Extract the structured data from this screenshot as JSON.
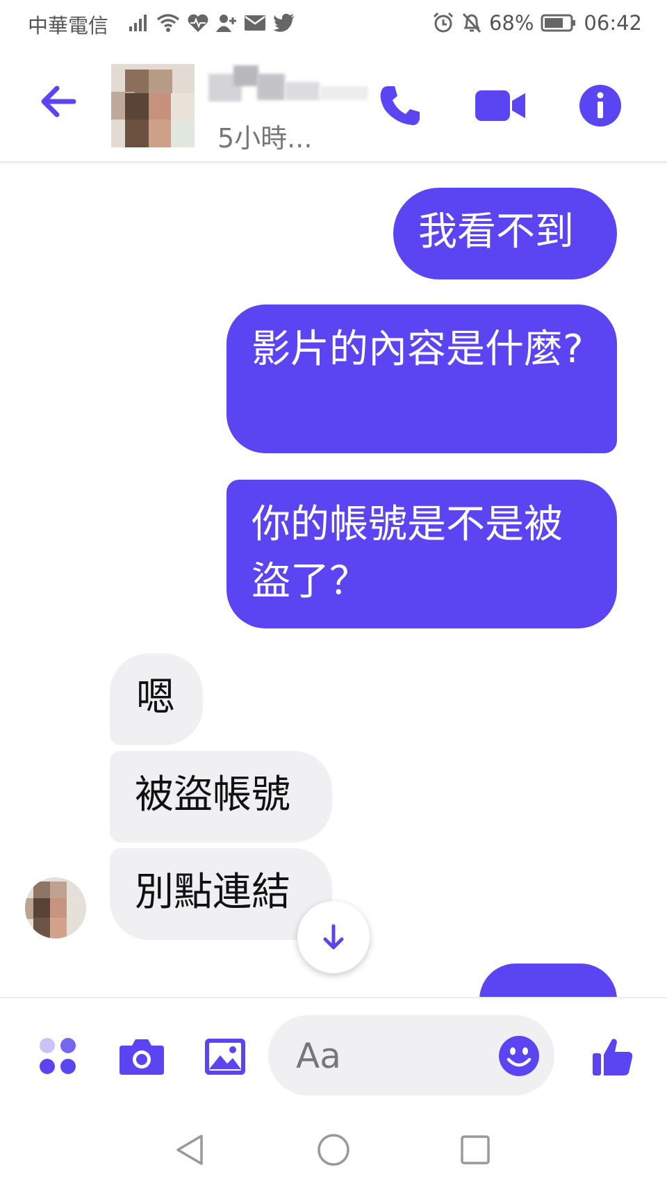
{
  "status_bar": {
    "carrier": "中華電信",
    "battery": "68%",
    "time": "06:42",
    "icons": [
      "signal-icon",
      "wifi-icon",
      "health-icon",
      "add-contact-icon",
      "mail-icon",
      "twitter-icon",
      "alarm-icon",
      "mute-icon",
      "battery-icon"
    ]
  },
  "header": {
    "contact_name": "",
    "last_active": "5小時...",
    "icons": [
      "back-arrow-icon",
      "phone-icon",
      "video-camera-icon",
      "info-icon"
    ],
    "accent_color": "#5b45f2"
  },
  "messages": [
    {
      "from": "me",
      "text": "我看不到"
    },
    {
      "from": "me",
      "text": "影片的內容是什麼?"
    },
    {
      "from": "me",
      "text": "你的帳號是不是被盜了？"
    },
    {
      "from": "them",
      "text": "嗯"
    },
    {
      "from": "them",
      "text": "被盜帳號"
    },
    {
      "from": "them",
      "text": "別點連結"
    }
  ],
  "composer": {
    "placeholder": "Aa",
    "icons": [
      "apps-icon",
      "camera-icon",
      "gallery-icon",
      "emoji-icon",
      "thumbs-up-icon"
    ]
  },
  "colors": {
    "outgoing_bubble": "#5b45f2",
    "incoming_bubble": "#f0f0f2"
  },
  "nav_bar": {
    "icons": [
      "back-triangle-icon",
      "home-circle-icon",
      "recents-square-icon"
    ]
  }
}
